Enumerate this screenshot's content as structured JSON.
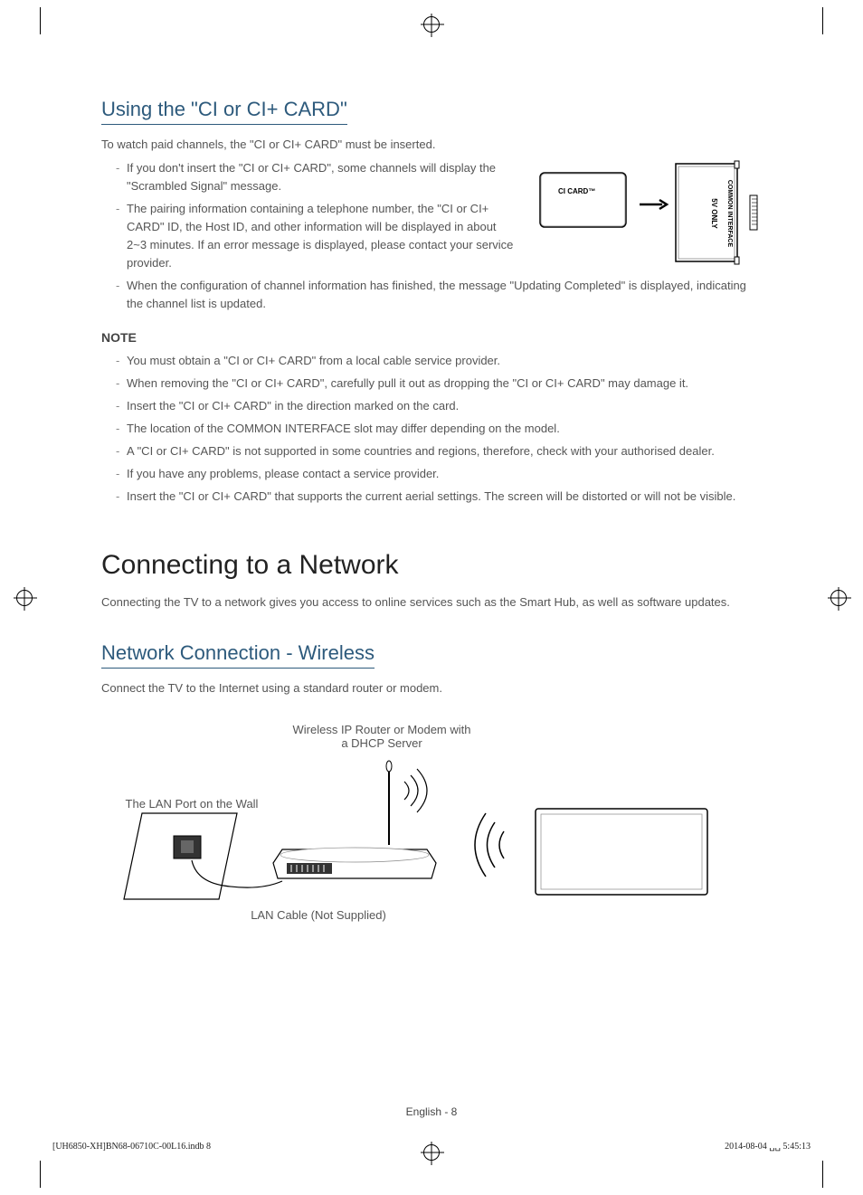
{
  "section1": {
    "title": "Using the \"CI or CI+ CARD\"",
    "intro": "To watch paid channels, the \"CI or CI+ CARD\" must be inserted.",
    "bullets_top": [
      "If you don't insert the \"CI or CI+ CARD\", some channels will display the \"Scrambled Signal\" message.",
      "The pairing information containing a telephone number, the \"CI or CI+ CARD\" ID, the Host ID, and other information will be displayed in about 2~3 minutes. If an error message is displayed, please contact your service provider."
    ],
    "bullets_wide": [
      "When the configuration of channel information has finished, the message \"Updating Completed\" is displayed, indicating the channel list is updated."
    ],
    "note_heading": "NOTE",
    "notes": [
      "You must obtain a \"CI or CI+ CARD\" from a local cable service provider.",
      "When removing the \"CI or CI+ CARD\", carefully pull it out as dropping the \"CI or CI+ CARD\" may damage it.",
      "Insert the \"CI or CI+ CARD\" in the direction marked on the card.",
      "The location of the COMMON INTERFACE slot may differ depending on the model.",
      "A \"CI or CI+ CARD\" is not supported in some countries and regions, therefore, check with your authorised dealer.",
      "If you have any problems, please contact a service provider.",
      "Insert the \"CI or CI+ CARD\" that supports the current aerial settings. The screen will be distorted or will not be visible."
    ],
    "card_label": "CI CARD™",
    "slot_label1": "5V ONLY",
    "slot_label2": "COMMON INTERFACE"
  },
  "section2": {
    "major_title": "Connecting to a Network",
    "intro": "Connecting the TV to a network gives you access to online services such as the Smart Hub, as well as software updates.",
    "subsection_title": "Network Connection - Wireless",
    "sub_intro": "Connect the TV to the Internet using a standard router or modem.",
    "diagram": {
      "router_label_1": "Wireless IP Router or Modem with",
      "router_label_2": "a DHCP Server",
      "lan_port_label": "The LAN Port on the Wall",
      "lan_cable_label": "LAN Cable (Not Supplied)"
    }
  },
  "footer": {
    "page": "English - 8",
    "left": "[UH6850-XH]BN68-06710C-00L16.indb   8",
    "right": "2014-08-04   ␣␣ 5:45:13"
  }
}
